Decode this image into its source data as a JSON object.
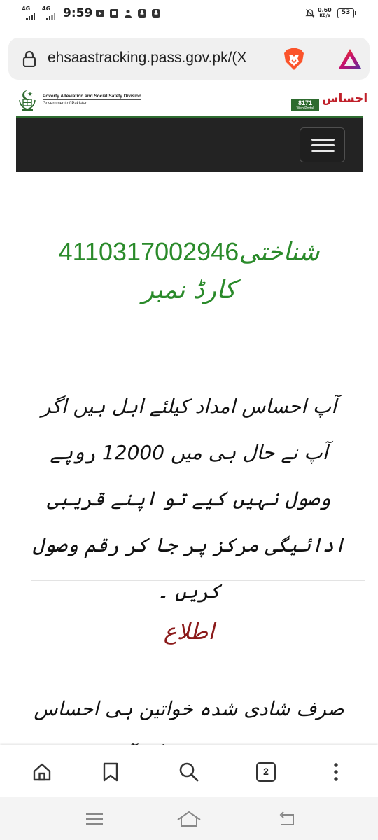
{
  "status_bar": {
    "sim1": "4G",
    "sim2": "4G",
    "time": "9:59",
    "net_speed_value": "0.60",
    "net_speed_unit": "KB/s",
    "battery": "53"
  },
  "browser": {
    "url": "ehsaastracking.pass.gov.pk/(X"
  },
  "site_header": {
    "org_line1": "Poverty Alleviation and Social Safety Division",
    "org_line2": "Government of Pakistan",
    "helpline": "8171",
    "helpline_sub": "Web Portal",
    "logo_text": "احساس"
  },
  "result": {
    "label_prefix": "شناختی",
    "cnic_number": "4110317002946",
    "label_suffix": "کارڈ نمبر",
    "message": "آپ احساس امداد کیلئے اہل ہیں اگر آپ نے حال ہی میں 12000 روپے وصول نہیں کیے تو اپنے قریبی ادائیگی مرکز پر جا کر رقم وصول کریں ۔",
    "notice_heading": "اطلاع",
    "notice_body": "صرف شادی شدہ خواتین ہی احساس کفالت کیلئے اہل ہیں اگر آپ مرد ہیں تو گھر کی خاتون کی معلومات فراہم کریں"
  },
  "toolbar": {
    "tab_count": "2"
  },
  "colors": {
    "accent_green": "#2a8a2a",
    "notice_red": "#8b1a1a",
    "navbar_bg": "#232323"
  },
  "icons": {
    "toolbar": [
      "home-icon",
      "bookmark-icon",
      "search-icon",
      "tabs-icon",
      "more-icon"
    ],
    "system_nav": [
      "menu-icon",
      "home-icon",
      "back-icon"
    ]
  }
}
